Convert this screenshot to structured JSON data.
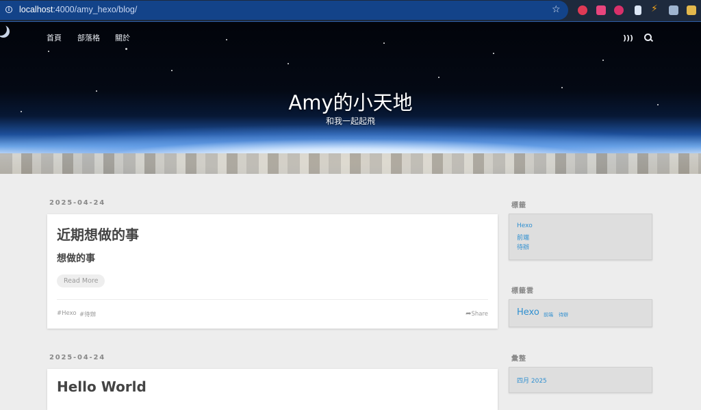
{
  "browser": {
    "url_host": "localhost",
    "url_path": ":4000/amy_hexo/blog/"
  },
  "nav": {
    "items": [
      "首頁",
      "部落格",
      "關於"
    ]
  },
  "hero": {
    "title": "Amy的小天地",
    "subtitle": "和我一起起飛"
  },
  "posts": [
    {
      "date": "2025-04-24",
      "title": "近期想做的事",
      "heading": "想做的事",
      "read_more": "Read More",
      "tags": [
        "#Hexo",
        "#待辦"
      ],
      "share": "Share"
    },
    {
      "date": "2025-04-24",
      "title": "Hello World"
    }
  ],
  "sidebar": {
    "tags_title": "標籤",
    "tags": [
      "Hexo",
      "前端",
      "待辦"
    ],
    "cloud_title": "標籤雲",
    "cloud": [
      "Hexo",
      "前端",
      "待辦"
    ],
    "archive_title": "彙整",
    "archive": [
      "四月 2025"
    ]
  },
  "colors": {
    "link": "#2f8fd0",
    "chrome_url_bar": "#134389"
  }
}
